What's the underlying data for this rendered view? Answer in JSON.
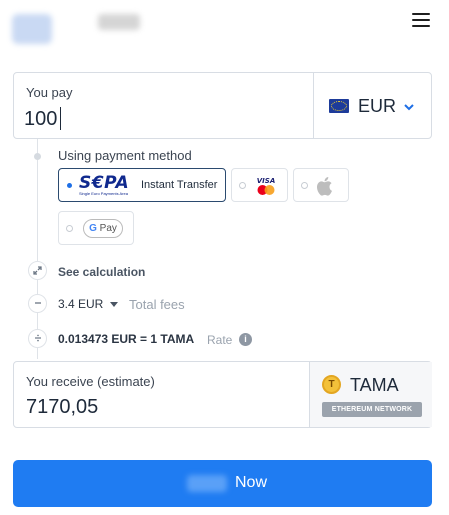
{
  "header": {
    "menu_icon": "hamburger-menu-icon"
  },
  "pay": {
    "label": "You pay",
    "amount": "100",
    "currency": "EUR",
    "flag_icon": "eu-flag-icon"
  },
  "payment_method": {
    "label": "Using payment method",
    "sepa_brand": "S€PA",
    "sepa_tagline": "Single Euro Payments Area",
    "sepa_label": "Instant Transfer",
    "options": [
      "sepa",
      "visa-mastercard",
      "apple-pay",
      "google-pay"
    ],
    "gpay_label": "Pay"
  },
  "calc": {
    "see_calculation": "See calculation",
    "fee_value": "3.4 EUR",
    "fee_label": "Total fees",
    "rate_value": "0.013473 EUR = 1 TAMA",
    "rate_label": "Rate"
  },
  "receive": {
    "label": "You receive (estimate)",
    "amount": "7170,05",
    "token": "TAMA",
    "network": "ETHEREUM NETWORK"
  },
  "cta": {
    "label": "Now"
  },
  "colors": {
    "accent": "#1f7cf2",
    "sepa_blue": "#10298e"
  }
}
